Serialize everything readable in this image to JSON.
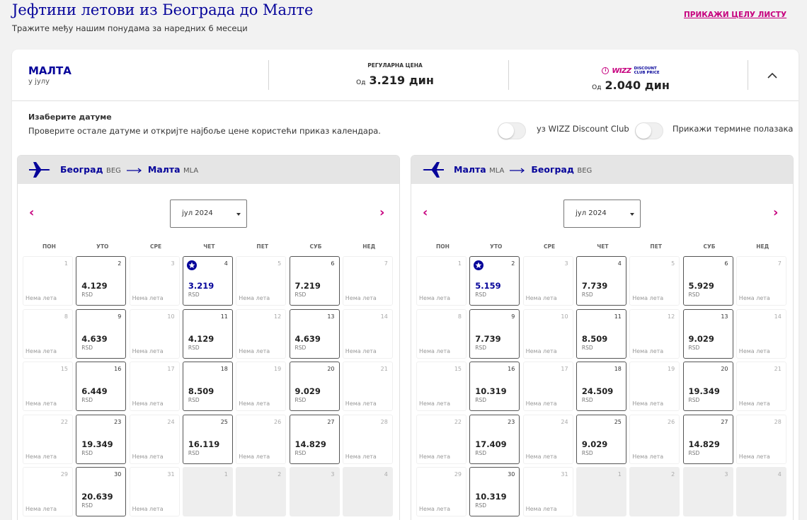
{
  "header": {
    "title": "Јефтини летови из Београда до Малте",
    "subtitle": "Тражите међу нашим понудама за наредних 6 месеци",
    "show_all_link": "ПРИКАЖИ ЦЕЛУ ЛИСТУ"
  },
  "summary": {
    "destination": "МАЛТА",
    "month": "у јулу",
    "regular_label": "РЕГУЛАРНА ЦЕНА",
    "regular_prefix": "Од",
    "regular_price": "3.219 дин",
    "wdc_logo": "WIZZ",
    "wdc_text_1": "DISCOUNT",
    "wdc_text_2": "CLUB PRICE",
    "wdc_prefix": "Од",
    "wdc_price": "2.040 дин"
  },
  "dates": {
    "title": "Изаберите датуме",
    "subtitle": "Проверите остале датуме и откријте најбоље цене користећи приказ календара.",
    "toggle_wdc_label": "уз WIZZ Discount Club",
    "toggle_times_label": "Прикажи термине полазака"
  },
  "colors": {
    "brand_blue": "#06049a",
    "brand_pink": "#c6007e"
  },
  "weekdays": [
    "ПОН",
    "УТО",
    "СРЕ",
    "ЧЕТ",
    "ПЕТ",
    "СУБ",
    "НЕД"
  ],
  "no_flights": "Нема лета",
  "currency": "RSD",
  "calendars": [
    {
      "from_city": "Београд",
      "from_code": "BEG",
      "to_city": "Малта",
      "to_code": "MLA",
      "month": "јул 2024",
      "days": [
        {
          "n": "1"
        },
        {
          "n": "2",
          "price": "4.129"
        },
        {
          "n": "3"
        },
        {
          "n": "4",
          "price": "3.219",
          "best": true
        },
        {
          "n": "5"
        },
        {
          "n": "6",
          "price": "7.219"
        },
        {
          "n": "7"
        },
        {
          "n": "8"
        },
        {
          "n": "9",
          "price": "4.639"
        },
        {
          "n": "10"
        },
        {
          "n": "11",
          "price": "4.129"
        },
        {
          "n": "12"
        },
        {
          "n": "13",
          "price": "4.639"
        },
        {
          "n": "14"
        },
        {
          "n": "15"
        },
        {
          "n": "16",
          "price": "6.449"
        },
        {
          "n": "17"
        },
        {
          "n": "18",
          "price": "8.509"
        },
        {
          "n": "19"
        },
        {
          "n": "20",
          "price": "9.029"
        },
        {
          "n": "21"
        },
        {
          "n": "22"
        },
        {
          "n": "23",
          "price": "19.349"
        },
        {
          "n": "24"
        },
        {
          "n": "25",
          "price": "16.119"
        },
        {
          "n": "26"
        },
        {
          "n": "27",
          "price": "14.829"
        },
        {
          "n": "28"
        },
        {
          "n": "29"
        },
        {
          "n": "30",
          "price": "20.639"
        },
        {
          "n": "31"
        },
        {
          "n": "1",
          "next": true
        },
        {
          "n": "2",
          "next": true
        },
        {
          "n": "3",
          "next": true
        },
        {
          "n": "4",
          "next": true
        }
      ]
    },
    {
      "from_city": "Малта",
      "from_code": "MLA",
      "to_city": "Београд",
      "to_code": "BEG",
      "month": "јул 2024",
      "days": [
        {
          "n": "1"
        },
        {
          "n": "2",
          "price": "5.159",
          "best": true
        },
        {
          "n": "3"
        },
        {
          "n": "4",
          "price": "7.739"
        },
        {
          "n": "5"
        },
        {
          "n": "6",
          "price": "5.929"
        },
        {
          "n": "7"
        },
        {
          "n": "8"
        },
        {
          "n": "9",
          "price": "7.739"
        },
        {
          "n": "10"
        },
        {
          "n": "11",
          "price": "8.509"
        },
        {
          "n": "12"
        },
        {
          "n": "13",
          "price": "9.029"
        },
        {
          "n": "14"
        },
        {
          "n": "15"
        },
        {
          "n": "16",
          "price": "10.319"
        },
        {
          "n": "17"
        },
        {
          "n": "18",
          "price": "24.509"
        },
        {
          "n": "19"
        },
        {
          "n": "20",
          "price": "19.349"
        },
        {
          "n": "21"
        },
        {
          "n": "22"
        },
        {
          "n": "23",
          "price": "17.409"
        },
        {
          "n": "24"
        },
        {
          "n": "25",
          "price": "9.029"
        },
        {
          "n": "26"
        },
        {
          "n": "27",
          "price": "14.829"
        },
        {
          "n": "28"
        },
        {
          "n": "29"
        },
        {
          "n": "30",
          "price": "10.319"
        },
        {
          "n": "31"
        },
        {
          "n": "1",
          "next": true
        },
        {
          "n": "2",
          "next": true
        },
        {
          "n": "3",
          "next": true
        },
        {
          "n": "4",
          "next": true
        }
      ]
    }
  ]
}
